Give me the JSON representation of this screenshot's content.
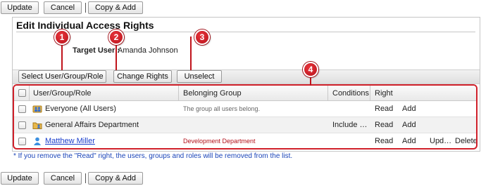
{
  "top_toolbar": {
    "update": "Update",
    "cancel": "Cancel",
    "copy_add": "Copy & Add"
  },
  "bottom_toolbar": {
    "update": "Update",
    "cancel": "Cancel",
    "copy_add": "Copy & Add"
  },
  "panel": {
    "title": "Edit Individual Access Rights",
    "target_user_label": "Target User :",
    "target_user_value": "Amanda Johnson"
  },
  "actions": {
    "select": "Select User/Group/Role",
    "change_rights": "Change Rights",
    "unselect": "Unselect"
  },
  "callouts": [
    "1",
    "2",
    "3",
    "4"
  ],
  "table": {
    "headers": {
      "name": "User/Group/Role",
      "group": "Belonging Group",
      "conditions": "Conditions",
      "right": "Right"
    },
    "rows": [
      {
        "name": "Everyone (All Users)",
        "icon": "all-users-icon",
        "group": "The group all users belong.",
        "conditions": "",
        "rights": [
          "Read",
          "Add"
        ]
      },
      {
        "name": "General Affairs Department",
        "icon": "department-icon",
        "group": "",
        "conditions": "Include S…",
        "rights": [
          "Read",
          "Add"
        ]
      },
      {
        "name": "Matthew Miller",
        "icon": "user-icon",
        "group": "Development Department",
        "conditions": "",
        "rights": [
          "Read",
          "Add",
          "Upd…",
          "Delete"
        ]
      }
    ]
  },
  "note": "* If you remove the \"Read\" right, the users, groups and roles will be removed from the list.",
  "colors": {
    "accent_red": "#d0202a",
    "link_blue": "#1a3ecc",
    "note_blue": "#1a44b8"
  }
}
